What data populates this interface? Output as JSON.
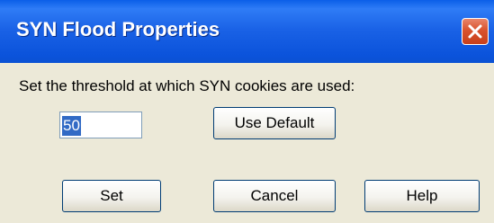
{
  "window": {
    "title": "SYN Flood Properties",
    "close_icon": "close-icon",
    "titlebar_color": "#0a5fe8",
    "close_color": "#d9532e"
  },
  "content": {
    "prompt": "Set the threshold at which SYN cookies are used:",
    "threshold_value": "50",
    "threshold_value_selected": true
  },
  "buttons": {
    "use_default": "Use Default",
    "set": "Set",
    "cancel": "Cancel",
    "help": "Help"
  }
}
